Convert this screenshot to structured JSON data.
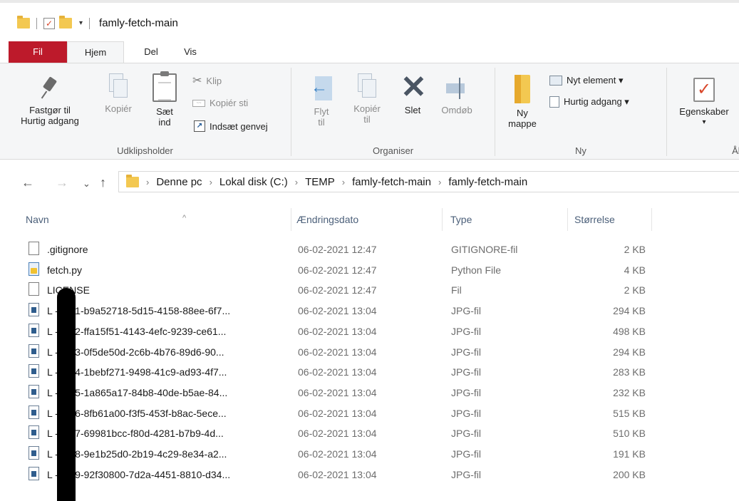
{
  "window": {
    "title": "famly-fetch-main"
  },
  "tabs": [
    "Fil",
    "Hjem",
    "Del",
    "Vis"
  ],
  "ribbon": {
    "clipboard": {
      "pin_label": "Fastgør til Hurtig adgang",
      "copy_label": "Kopiér",
      "paste_label": "Sæt ind",
      "cut_label": "Klip",
      "copy_path_label": "Kopiér sti",
      "paste_shortcut_label": "Indsæt genvej",
      "group_label": "Udklipsholder"
    },
    "organize": {
      "move_label": "Flyt til",
      "copy_to_label": "Kopiér til",
      "delete_label": "Slet",
      "rename_label": "Omdøb",
      "group_label": "Organiser"
    },
    "new": {
      "new_folder_label": "Ny mappe",
      "new_item_label": "Nyt element ▾",
      "quick_access_label": "Hurtig adgang ▾",
      "group_label": "Ny"
    },
    "open": {
      "properties_label": "Egenskaber",
      "group_label_partial": "Åb"
    }
  },
  "navigation": {
    "back": "←",
    "forward": "→",
    "recent": "⌄",
    "up": "↑",
    "breadcrumb": [
      "Denne pc",
      "Lokal disk (C:)",
      "TEMP",
      "famly-fetch-main",
      "famly-fetch-main"
    ]
  },
  "columns": {
    "name": "Navn",
    "date": "Ændringsdato",
    "type": "Type",
    "size": "Størrelse"
  },
  "files": [
    {
      "name": ".gitignore",
      "date": "06-02-2021 12:47",
      "type": "GITIGNORE-fil",
      "size": "2 KB",
      "icon": "generic"
    },
    {
      "name": "fetch.py",
      "date": "06-02-2021 12:47",
      "type": "Python File",
      "size": "4 KB",
      "icon": "py"
    },
    {
      "name": "LICENSE",
      "date": "06-02-2021 12:47",
      "type": "Fil",
      "size": "2 KB",
      "icon": "generic"
    },
    {
      "name": "L      -0001-b9a52718-5d15-4158-88ee-6f7...",
      "date": "06-02-2021 13:04",
      "type": "JPG-fil",
      "size": "294 KB",
      "icon": "jpg"
    },
    {
      "name": "L      -0002-ffa15f51-4143-4efc-9239-ce61...",
      "date": "06-02-2021 13:04",
      "type": "JPG-fil",
      "size": "498 KB",
      "icon": "jpg"
    },
    {
      "name": "L      -0003-0f5de50d-2c6b-4b76-89d6-90...",
      "date": "06-02-2021 13:04",
      "type": "JPG-fil",
      "size": "294 KB",
      "icon": "jpg"
    },
    {
      "name": "L      -0004-1bebf271-9498-41c9-ad93-4f7...",
      "date": "06-02-2021 13:04",
      "type": "JPG-fil",
      "size": "283 KB",
      "icon": "jpg"
    },
    {
      "name": "L      -0005-1a865a17-84b8-40de-b5ae-84...",
      "date": "06-02-2021 13:04",
      "type": "JPG-fil",
      "size": "232 KB",
      "icon": "jpg"
    },
    {
      "name": "L      -0006-8fb61a00-f3f5-453f-b8ac-5ece...",
      "date": "06-02-2021 13:04",
      "type": "JPG-fil",
      "size": "515 KB",
      "icon": "jpg"
    },
    {
      "name": "L      -0007-69981bcc-f80d-4281-b7b9-4d...",
      "date": "06-02-2021 13:04",
      "type": "JPG-fil",
      "size": "510 KB",
      "icon": "jpg"
    },
    {
      "name": "L      -0008-9e1b25d0-2b19-4c29-8e34-a2...",
      "date": "06-02-2021 13:04",
      "type": "JPG-fil",
      "size": "191 KB",
      "icon": "jpg"
    },
    {
      "name": "L      -0009-92f30800-7d2a-4451-8810-d34...",
      "date": "06-02-2021 13:04",
      "type": "JPG-fil",
      "size": "200 KB",
      "icon": "jpg"
    }
  ],
  "colors": {
    "file_tab": "#bd1a2b",
    "ribbon_bg": "#f5f6f7",
    "header_text": "#4c607a"
  }
}
